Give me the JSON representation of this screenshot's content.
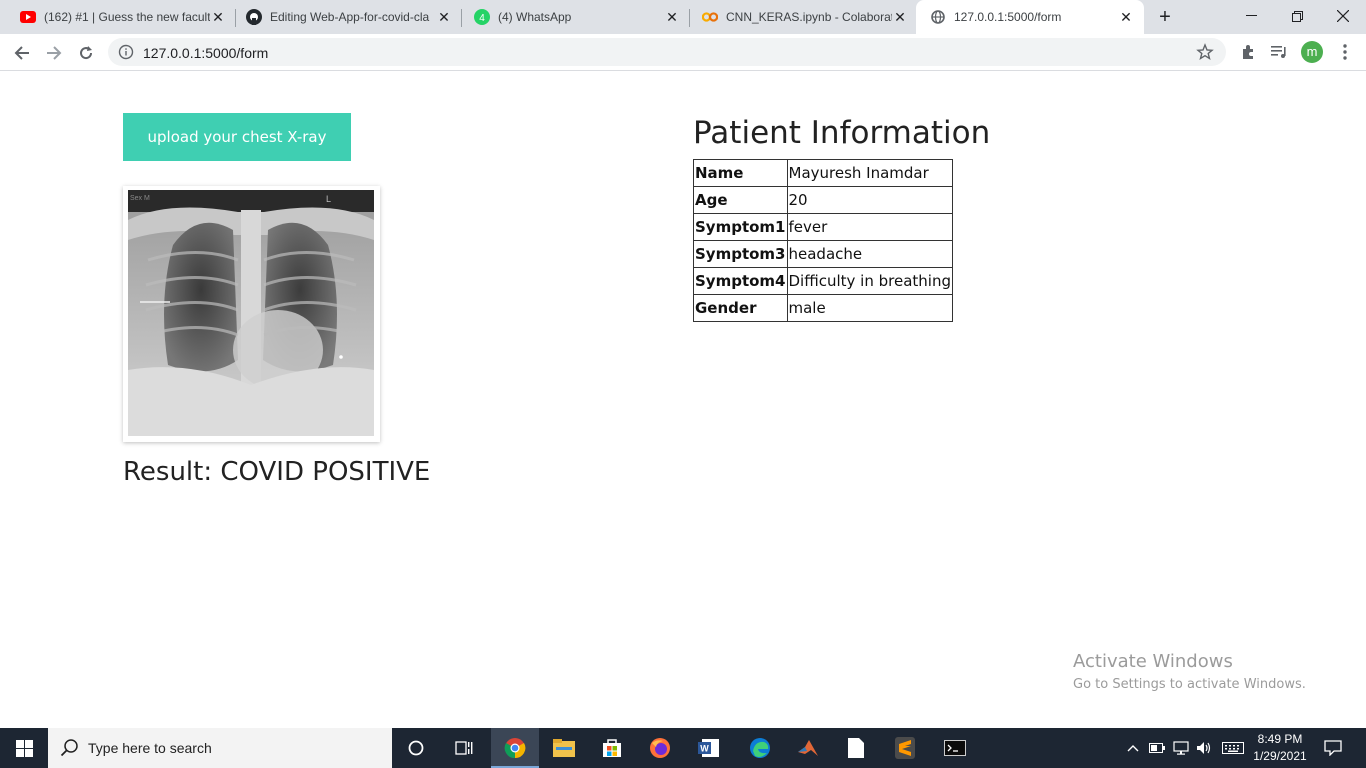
{
  "browser": {
    "tabs": [
      {
        "title": "(162) #1 | Guess the new facult",
        "icon": "youtube-icon"
      },
      {
        "title": "Editing Web-App-for-covid-cla",
        "icon": "github-icon"
      },
      {
        "title": "(4) WhatsApp",
        "icon": "whatsapp-icon",
        "badge": "4"
      },
      {
        "title": "CNN_KERAS.ipynb - Colaborato",
        "icon": "colab-icon"
      },
      {
        "title": "127.0.0.1:5000/form",
        "icon": "globe-icon",
        "active": true
      }
    ],
    "new_tab": "+",
    "url": "127.0.0.1:5000/form",
    "profile_initial": "m"
  },
  "page": {
    "upload_button": "upload your chest X-ray",
    "xray_corner_text": "Sex M",
    "xray_marker": "L",
    "result_text": "Result: COVID POSITIVE",
    "patient_title": "Patient Information",
    "patient_rows": [
      {
        "label": "Name",
        "value": "Mayuresh Inamdar"
      },
      {
        "label": "Age",
        "value": "20"
      },
      {
        "label": "Symptom1",
        "value": "fever"
      },
      {
        "label": "Symptom3",
        "value": "headache"
      },
      {
        "label": "Symptom4",
        "value": "Difficulty in breathing"
      },
      {
        "label": "Gender",
        "value": "male"
      }
    ]
  },
  "watermark": {
    "line1": "Activate Windows",
    "line2": "Go to Settings to activate Windows."
  },
  "taskbar": {
    "search_placeholder": "Type here to search",
    "time": "8:49 PM",
    "date": "1/29/2021"
  },
  "colors": {
    "accent_button": "#3fcfb2",
    "tabstrip": "#dee1e6",
    "taskbar": "#1d2633"
  }
}
